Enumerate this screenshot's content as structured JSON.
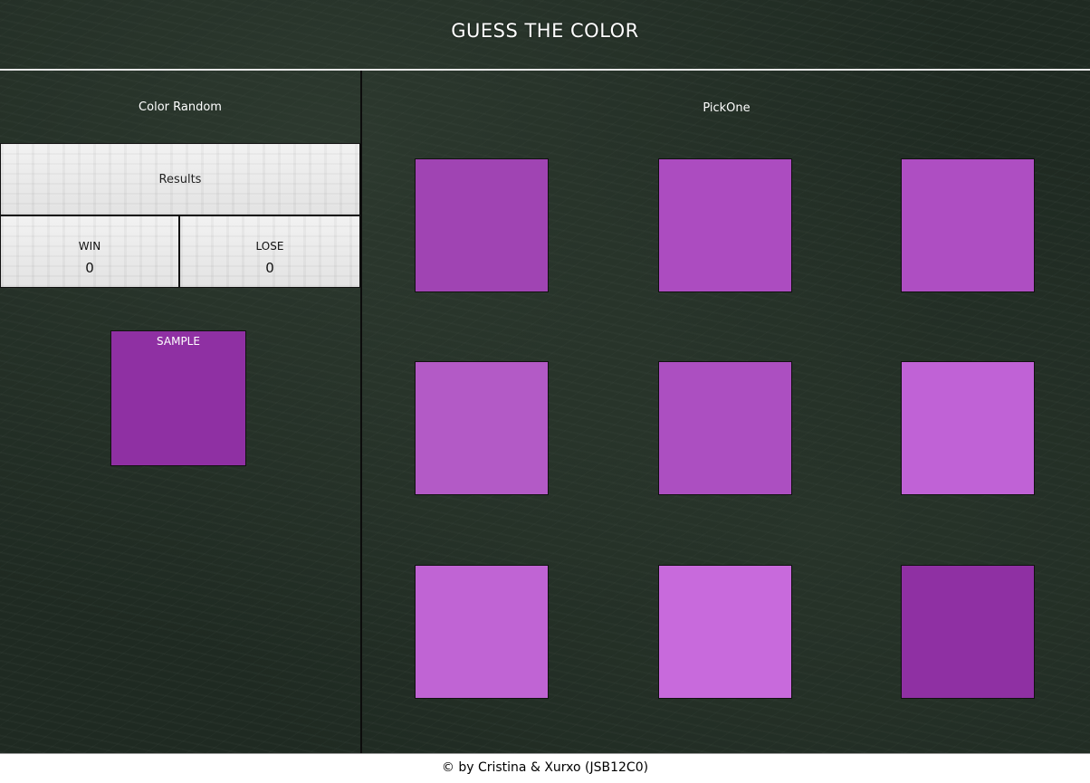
{
  "header": {
    "title": "GUESS THE COLOR"
  },
  "left": {
    "caption": "Color Random",
    "results": {
      "title": "Results",
      "win_label": "WIN",
      "win_value": "0",
      "lose_label": "LOSE",
      "lose_value": "0"
    },
    "sample": {
      "label": "SAMPLE",
      "color": "#8f30a3"
    }
  },
  "right": {
    "caption": "PickOne",
    "swatches": [
      {
        "color": "#a044b3"
      },
      {
        "color": "#ac4cc0"
      },
      {
        "color": "#ae4ec2"
      },
      {
        "color": "#b35ac6"
      },
      {
        "color": "#ac4fc1"
      },
      {
        "color": "#c062d6"
      },
      {
        "color": "#c064d4"
      },
      {
        "color": "#c86adc"
      },
      {
        "color": "#8f30a3"
      }
    ]
  },
  "footer": {
    "credit": "© by Cristina & Xurxo (JSB12C0)"
  }
}
